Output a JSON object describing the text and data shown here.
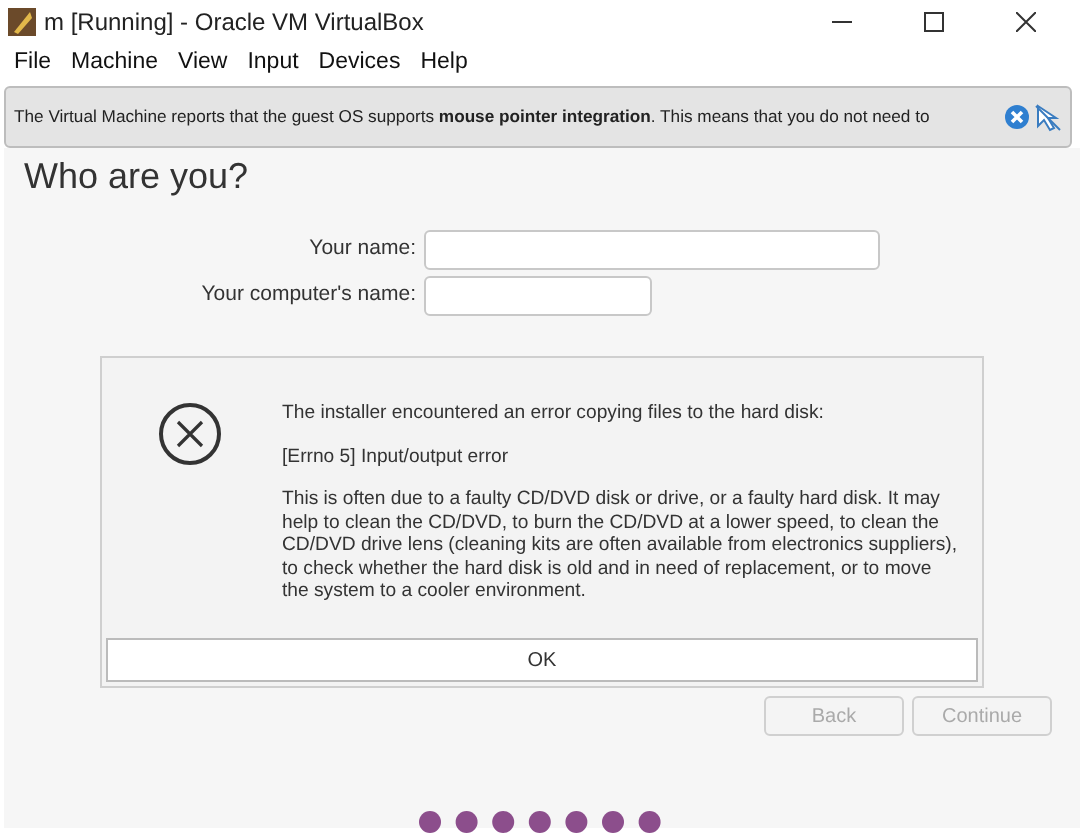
{
  "window": {
    "title": "m [Running] - Oracle VM VirtualBox"
  },
  "menu": [
    "File",
    "Machine",
    "View",
    "Input",
    "Devices",
    "Help"
  ],
  "notification": {
    "text": "The Virtual Machine reports that the guest OS supports **mouse pointer integration**. This means that you do not need to"
  },
  "page": {
    "heading": "Who are you?",
    "fields": [
      {
        "label": "Your name:"
      },
      {
        "label": "Your computer's name:"
      }
    ],
    "buttons": [
      {
        "label": "Back",
        "disabled": true
      },
      {
        "label": "Continue",
        "disabled": true
      }
    ]
  },
  "dialog": {
    "title": "The installer encountered an error copying files to the hard disk:",
    "error": "[Errno 5] Input/output error",
    "body": "This is often due to a faulty CD/DVD disk or drive, or a faulty hard disk. It may help to clean the CD/DVD, to burn the CD/DVD at a lower speed, to clean the CD/DVD drive lens (cleaning kits are often available from electronics suppliers), to check whether the hard disk is old and in need of replacement, or to move the system to a cooler environment.",
    "button": "OK"
  }
}
